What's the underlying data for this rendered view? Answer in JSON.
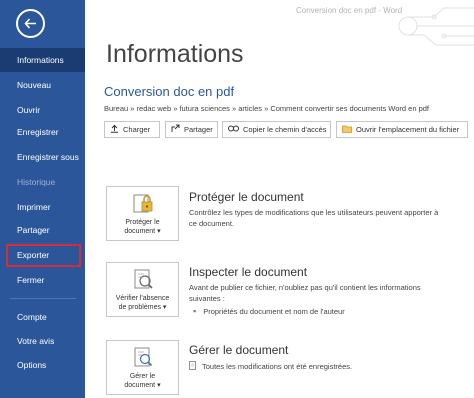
{
  "window": {
    "title": "Conversion doc en pdf",
    "app": "Word"
  },
  "sidebar": {
    "items": [
      {
        "label": "Informations",
        "state": "active"
      },
      {
        "label": "Nouveau"
      },
      {
        "label": "Ouvrir"
      },
      {
        "label": "Enregistrer"
      },
      {
        "label": "Enregistrer sous"
      },
      {
        "label": "Historique",
        "state": "disabled"
      },
      {
        "label": "Imprimer"
      },
      {
        "label": "Partager"
      },
      {
        "label": "Exporter",
        "state": "highlighted"
      },
      {
        "label": "Fermer"
      },
      {
        "label": "Compte"
      },
      {
        "label": "Votre avis"
      },
      {
        "label": "Options"
      }
    ]
  },
  "main": {
    "title": "Informations",
    "doc_name": "Conversion doc en pdf",
    "breadcrumb": "Bureau » redac web » futura sciences » articles » Comment convertir ses documents Word en pdf",
    "toolbar": {
      "upload": "Charger",
      "share": "Partager",
      "copy_path": "Copier le chemin d'accès",
      "open_location": "Ouvrir l'emplacement du fichier"
    },
    "sections": [
      {
        "button_lines": [
          "Protéger le",
          "document ▾"
        ],
        "title": "Protéger le document",
        "description": "Contrôlez les types de modifications que les utilisateurs peuvent apporter à ce document."
      },
      {
        "button_lines": [
          "Vérifier l'absence",
          "de problèmes ▾"
        ],
        "title": "Inspecter le document",
        "description": "Avant de publier ce fichier, n'oubliez pas qu'il contient les informations suivantes :",
        "bullets": [
          "Propriétés du document et nom de l'auteur"
        ]
      },
      {
        "button_lines": [
          "Gérer le",
          "document ▾"
        ],
        "title": "Gérer le document",
        "bullets": [
          "Toutes les modifications ont été enregistrées."
        ]
      }
    ]
  },
  "colors": {
    "sidebar": "#2b579a",
    "sidebar_active": "#1b3c73",
    "highlight_border": "#d52b3b",
    "accent_text": "#2b579a"
  },
  "icons": [
    "back-arrow-icon",
    "upload-icon",
    "share-icon",
    "link-icon",
    "folder-icon",
    "lock-key-icon",
    "inspect-document-icon",
    "manage-document-icon"
  ]
}
